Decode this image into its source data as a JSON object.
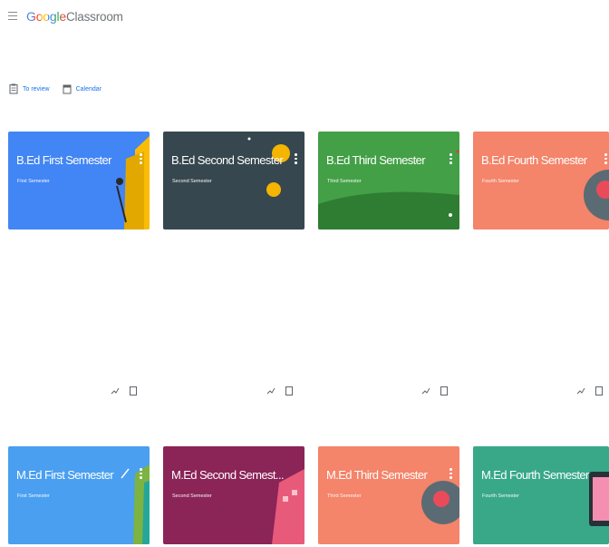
{
  "app": {
    "brand_google": "Google",
    "brand_product": "Classroom"
  },
  "toolbar": {
    "to_review": "To review",
    "calendar": "Calendar"
  },
  "colors": {
    "bed1": "#4285f4",
    "bed2": "#37474f",
    "bed3": "#43a047",
    "bed4": "#f4846a",
    "med1": "#4a9ff0",
    "med2": "#8b2457",
    "med3": "#f4846a",
    "med4": "#38a889"
  },
  "classes": [
    {
      "title": "B.Ed First Semester",
      "section": "First Semester"
    },
    {
      "title": "B.Ed Second Semester",
      "section": "Second Semester"
    },
    {
      "title": "B.Ed Third Semester",
      "section": "Third Semester"
    },
    {
      "title": "B.Ed Fourth Semester",
      "section": "Fourth Semester"
    },
    {
      "title": "M.Ed First Semester",
      "section": "First Semester"
    },
    {
      "title": "M.Ed Second Semest...",
      "section": "Second Semester"
    },
    {
      "title": "M.Ed Third Semester",
      "section": "Third Semester"
    },
    {
      "title": "M.Ed Fourth Semester",
      "section": "Fourth Semester"
    }
  ]
}
